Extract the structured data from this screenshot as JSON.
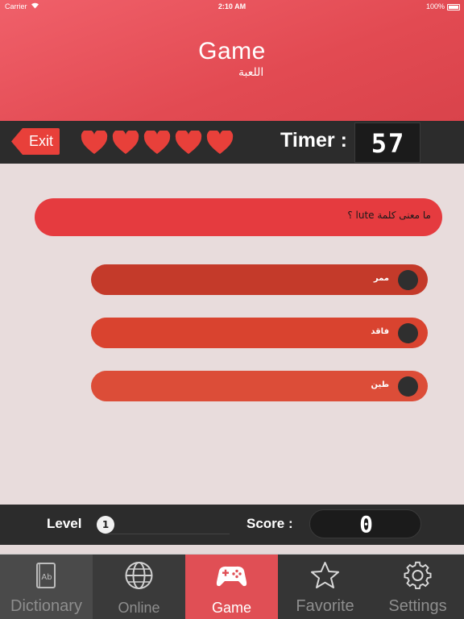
{
  "status_bar": {
    "carrier": "Carrier",
    "time": "2:10 AM",
    "battery": "100%"
  },
  "header": {
    "title": "Game",
    "subtitle": "اللعبة"
  },
  "toolbar": {
    "exit_label": "Exit",
    "hearts": 5,
    "timer_label": "Timer :",
    "timer_value": "57"
  },
  "question": {
    "text": "ما معنى كلمة lute ؟"
  },
  "answers": [
    {
      "label": "ممر"
    },
    {
      "label": "فاقد"
    },
    {
      "label": "طين"
    }
  ],
  "bottom": {
    "level_label": "Level",
    "level_value": "1",
    "score_label": "Score :",
    "score_value": "0"
  },
  "tabs": [
    {
      "label": "Dictionary",
      "icon": "dictionary-icon"
    },
    {
      "label": "Online",
      "icon": "globe-icon"
    },
    {
      "label": "Game",
      "icon": "gamepad-icon",
      "selected": true
    },
    {
      "label": "Favorite",
      "icon": "star-icon"
    },
    {
      "label": "Settings",
      "icon": "gear-icon"
    }
  ],
  "colors": {
    "accent": "#e24a52",
    "dark_bar": "#2c2c2c",
    "heart": "#e8403a",
    "background": "#e8dcdc"
  }
}
